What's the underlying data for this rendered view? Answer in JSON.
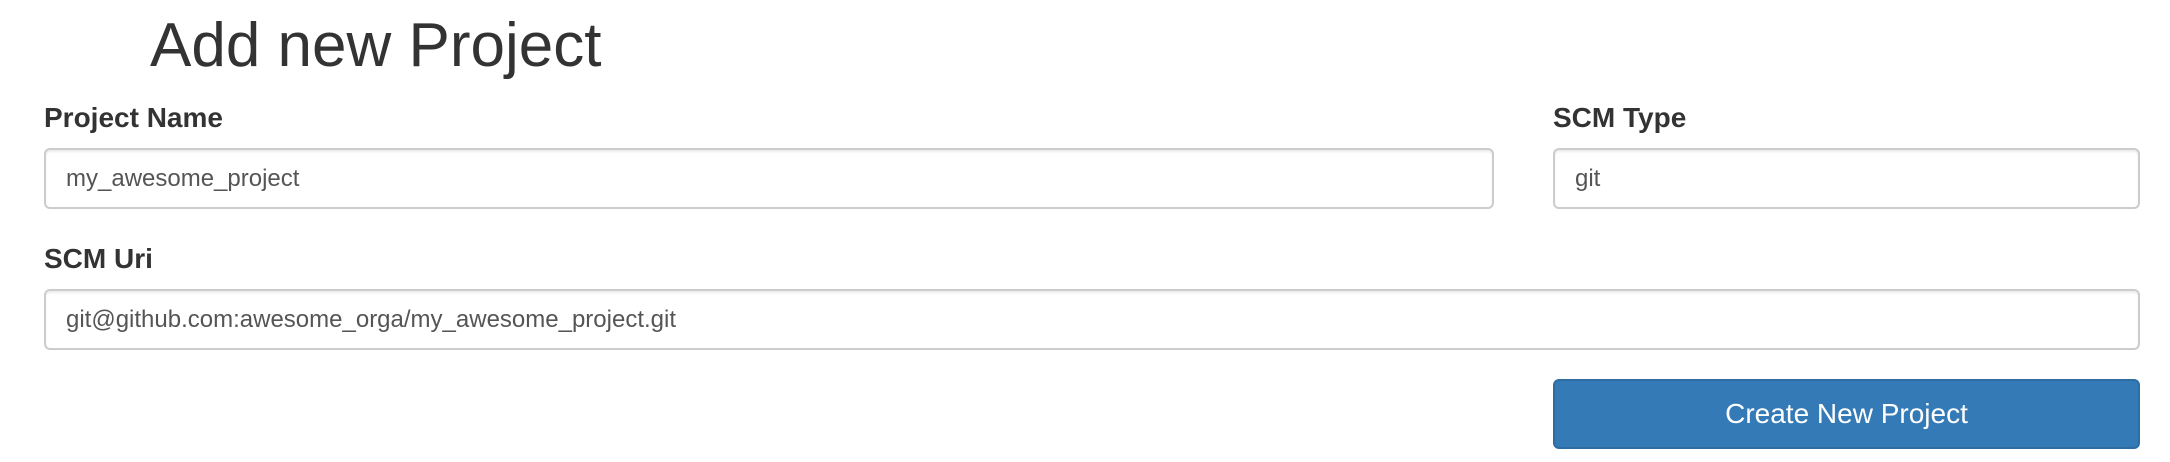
{
  "page": {
    "title": "Add new Project"
  },
  "form": {
    "project_name": {
      "label": "Project Name",
      "value": "my_awesome_project"
    },
    "scm_type": {
      "label": "SCM Type",
      "value": "git"
    },
    "scm_uri": {
      "label": "SCM Uri",
      "value": "git@github.com:awesome_orga/my_awesome_project.git"
    },
    "submit_label": "Create New Project"
  },
  "colors": {
    "primary": "#337ab7",
    "text": "#333333",
    "input_border": "#cccccc"
  }
}
